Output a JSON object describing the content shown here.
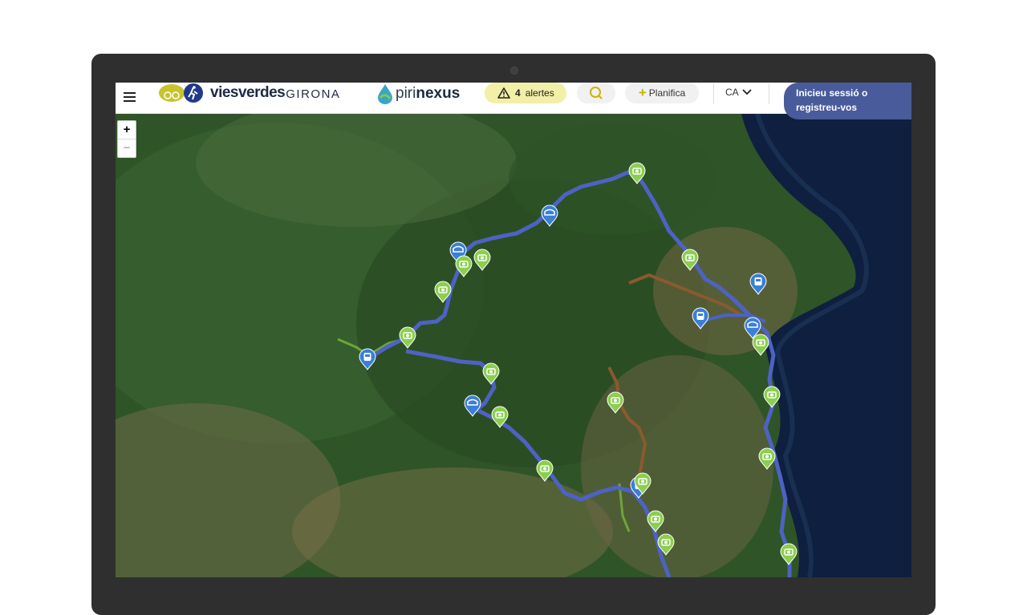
{
  "header": {
    "menu_icon": "hamburger-menu-icon",
    "logo_primary": "viesverdes",
    "logo_secondary": "GIRONA",
    "logo_partner_prefix": "piri",
    "logo_partner_suffix": "nexus",
    "alerts_count": "4",
    "alerts_label": "alertes",
    "plan_label": "Planifica",
    "language": "CA",
    "login_label_line1": "Inicieu sessió o",
    "login_label_line2": "registreu-vos"
  },
  "map": {
    "zoom_in_label": "+",
    "zoom_out_label": "−",
    "colors": {
      "route_main": "#4e62c4",
      "route_brown": "#8a5a30",
      "route_green": "#6fa43a",
      "marker_photo": "#8cce4f",
      "marker_transport": "#3a7fd8"
    },
    "markers": [
      {
        "type": "photo",
        "icon": "camera-icon"
      },
      {
        "type": "transport",
        "icon": "train-icon"
      },
      {
        "type": "bus",
        "icon": "bus-icon"
      }
    ]
  }
}
